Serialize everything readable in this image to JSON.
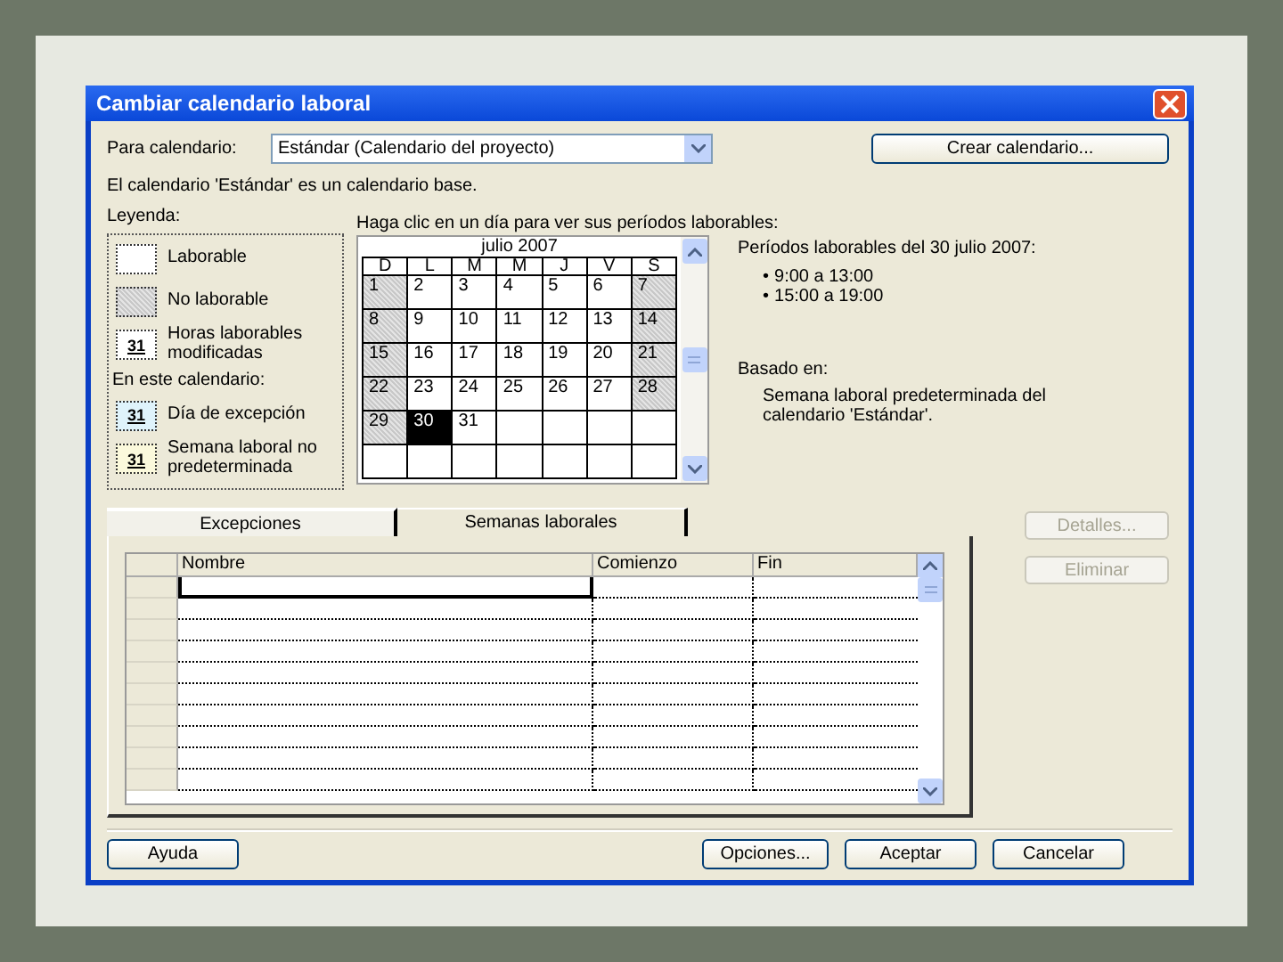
{
  "window": {
    "title": "Cambiar calendario laboral"
  },
  "calendar_select": {
    "label": "Para calendario:",
    "value": "Estándar (Calendario del proyecto)"
  },
  "create_button": "Crear calendario...",
  "base_note": "El calendario 'Estándar' es un calendario base.",
  "legend": {
    "title": "Leyenda:",
    "items": [
      {
        "kind": "working",
        "label": "Laborable"
      },
      {
        "kind": "nonworking",
        "label": "No laborable"
      },
      {
        "kind": "modified",
        "mark": "31",
        "label": "Horas laborables modificadas"
      }
    ],
    "subheading": "En este calendario:",
    "calendar_items": [
      {
        "kind": "exception",
        "mark": "31",
        "label": "Día de excepción"
      },
      {
        "kind": "nondefault",
        "mark": "31",
        "label": "Semana laboral no predeterminada"
      }
    ]
  },
  "calendar": {
    "prompt": "Haga clic en un día para ver sus períodos laborables:",
    "month": "julio 2007",
    "weekdays": [
      "D",
      "L",
      "M",
      "M",
      "J",
      "V",
      "S"
    ],
    "weeks": [
      [
        {
          "day": "1",
          "nonworking": true,
          "selected": false
        },
        {
          "day": "2",
          "nonworking": false,
          "selected": false
        },
        {
          "day": "3",
          "nonworking": false,
          "selected": false
        },
        {
          "day": "4",
          "nonworking": false,
          "selected": false
        },
        {
          "day": "5",
          "nonworking": false,
          "selected": false
        },
        {
          "day": "6",
          "nonworking": false,
          "selected": false
        },
        {
          "day": "7",
          "nonworking": true,
          "selected": false
        }
      ],
      [
        {
          "day": "8",
          "nonworking": true,
          "selected": false
        },
        {
          "day": "9",
          "nonworking": false,
          "selected": false
        },
        {
          "day": "10",
          "nonworking": false,
          "selected": false
        },
        {
          "day": "11",
          "nonworking": false,
          "selected": false
        },
        {
          "day": "12",
          "nonworking": false,
          "selected": false
        },
        {
          "day": "13",
          "nonworking": false,
          "selected": false
        },
        {
          "day": "14",
          "nonworking": true,
          "selected": false
        }
      ],
      [
        {
          "day": "15",
          "nonworking": true,
          "selected": false
        },
        {
          "day": "16",
          "nonworking": false,
          "selected": false
        },
        {
          "day": "17",
          "nonworking": false,
          "selected": false
        },
        {
          "day": "18",
          "nonworking": false,
          "selected": false
        },
        {
          "day": "19",
          "nonworking": false,
          "selected": false
        },
        {
          "day": "20",
          "nonworking": false,
          "selected": false
        },
        {
          "day": "21",
          "nonworking": true,
          "selected": false
        }
      ],
      [
        {
          "day": "22",
          "nonworking": true,
          "selected": false
        },
        {
          "day": "23",
          "nonworking": false,
          "selected": false
        },
        {
          "day": "24",
          "nonworking": false,
          "selected": false
        },
        {
          "day": "25",
          "nonworking": false,
          "selected": false
        },
        {
          "day": "26",
          "nonworking": false,
          "selected": false
        },
        {
          "day": "27",
          "nonworking": false,
          "selected": false
        },
        {
          "day": "28",
          "nonworking": true,
          "selected": false
        }
      ],
      [
        {
          "day": "29",
          "nonworking": true,
          "selected": false
        },
        {
          "day": "30",
          "nonworking": false,
          "selected": true
        },
        {
          "day": "31",
          "nonworking": false,
          "selected": false
        }
      ]
    ]
  },
  "periods": {
    "title": "Períodos laborables del 30 julio 2007:",
    "bullet": "•",
    "items": [
      "9:00 a 13:00",
      "15:00 a 19:00"
    ]
  },
  "based_on": {
    "title": "Basado en:",
    "text": "Semana laboral predeterminada del calendario 'Estándar'."
  },
  "tabs": [
    {
      "label": "Excepciones",
      "selected": true
    },
    {
      "label": "Semanas laborales",
      "selected": false
    }
  ],
  "table": {
    "columns": [
      "Nombre",
      "Comienzo",
      "Fin"
    ]
  },
  "side_buttons": [
    {
      "label": "Detalles...",
      "disabled": true
    },
    {
      "label": "Eliminar",
      "disabled": true
    }
  ],
  "footer": {
    "left": [
      "Ayuda"
    ],
    "right": [
      "Opciones...",
      "Aceptar",
      "Cancelar"
    ]
  }
}
